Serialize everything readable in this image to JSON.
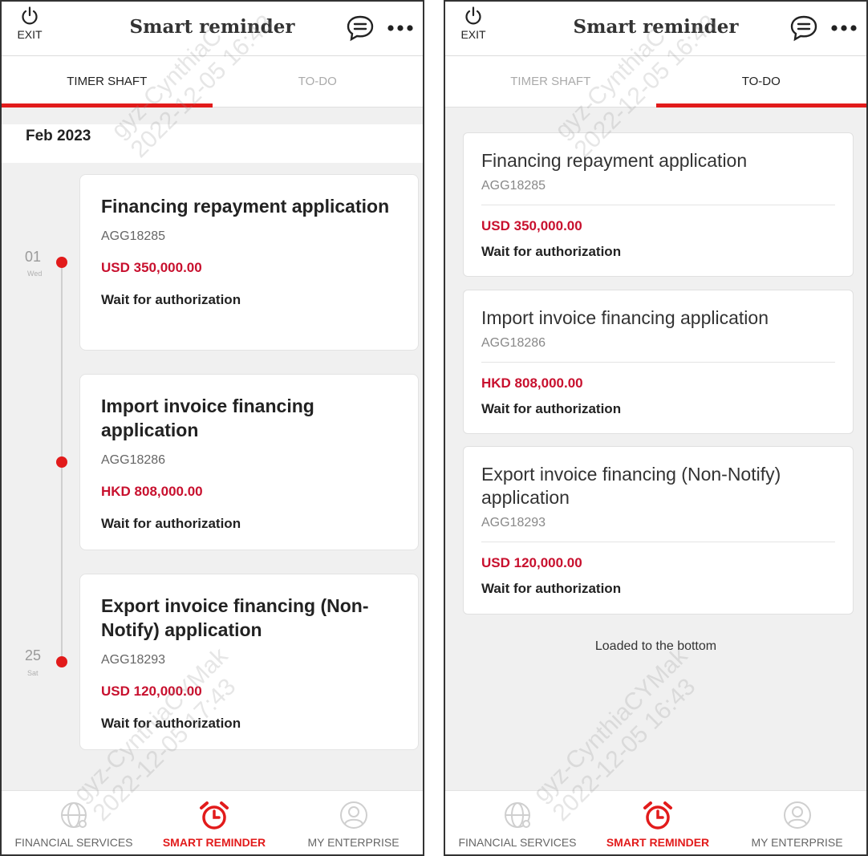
{
  "colors": {
    "accent": "#e21b1b",
    "amount": "#c8102e",
    "background": "#f0f0f0"
  },
  "header": {
    "exit_label": "EXIT",
    "title": "Smart reminder",
    "exit_icon": "power-icon",
    "message_icon": "message-icon",
    "more_icon": "more-icon"
  },
  "tabs": {
    "timer": "TIMER SHAFT",
    "todo": "TO-DO"
  },
  "left": {
    "active_tab": "TIMER SHAFT",
    "month": "Feb 2023",
    "markers": [
      {
        "day": "01",
        "weekday": "Wed"
      },
      {
        "day": "25",
        "weekday": "Sat"
      }
    ],
    "cards": [
      {
        "title": "Financing repayment application",
        "ref": "AGG18285",
        "amount": "USD 350,000.00",
        "status": "Wait for authorization"
      },
      {
        "title": "Import invoice financing application",
        "ref": "AGG18286",
        "amount": "HKD 808,000.00",
        "status": "Wait for authorization"
      },
      {
        "title": "Export invoice financing (Non-Notify) application",
        "ref": "AGG18293",
        "amount": "USD 120,000.00",
        "status": "Wait for authorization"
      }
    ]
  },
  "right": {
    "active_tab": "TO-DO",
    "cards": [
      {
        "title": "Financing repayment application",
        "ref": "AGG18285",
        "amount": "USD 350,000.00",
        "status": "Wait for authorization"
      },
      {
        "title": "Import invoice financing application",
        "ref": "AGG18286",
        "amount": "HKD 808,000.00",
        "status": "Wait for authorization"
      },
      {
        "title": "Export invoice financing (Non-Notify) application",
        "ref": "AGG18293",
        "amount": "USD 120,000.00",
        "status": "Wait for authorization"
      }
    ],
    "footer_note": "Loaded to the bottom"
  },
  "bottom_nav": {
    "financial": {
      "label": "FINANCIAL SERVICES",
      "icon": "globe-icon"
    },
    "smart": {
      "label": "SMART REMINDER",
      "icon": "alarm-clock-icon"
    },
    "enterprise": {
      "label": "MY ENTERPRISE",
      "icon": "user-icon"
    }
  },
  "watermarks": {
    "left_top": "gyz-CynthiaC\n2022-12-05 16:43",
    "left_bottom": "gyz-CynthiaCYMak\n2022-12-05 17:43",
    "right_top": "gyz-CynthiaC\n2022-12-05 16:43",
    "right_bottom": "gyz-CynthiaCYMak\n2022-12-05 16:43"
  }
}
